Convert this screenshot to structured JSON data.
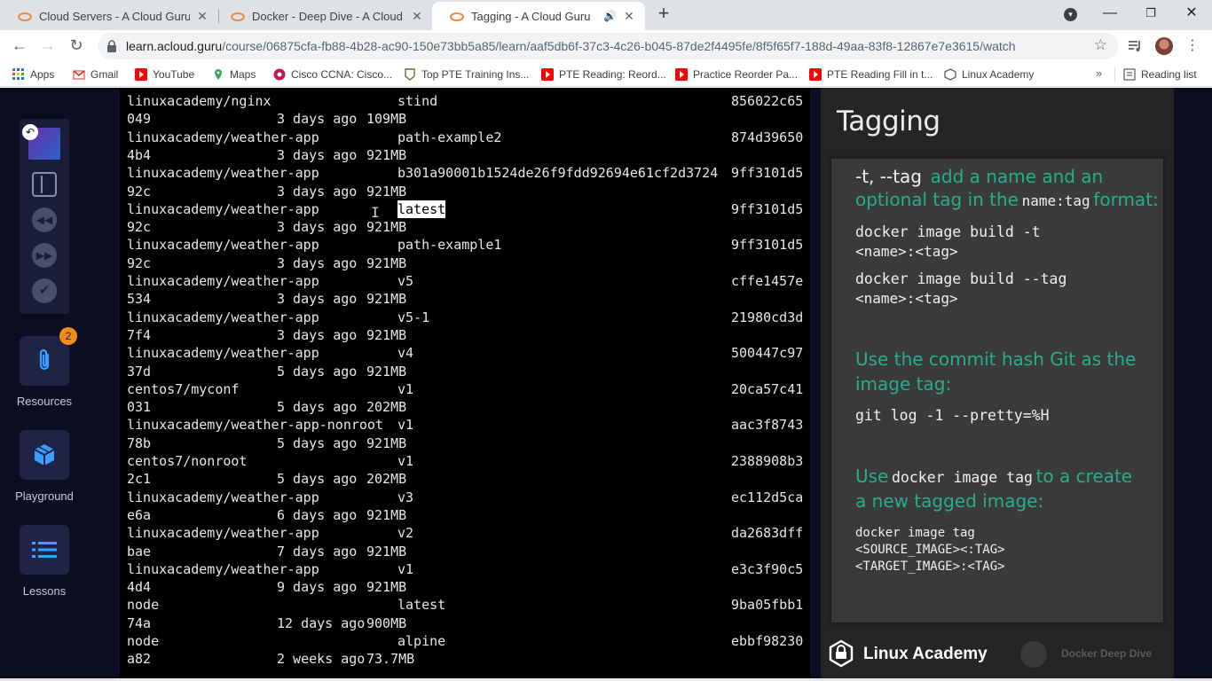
{
  "tabs": [
    {
      "title": "Cloud Servers - A Cloud Guru",
      "active": false
    },
    {
      "title": "Docker - Deep Dive - A Cloud Gu",
      "active": false
    },
    {
      "title": "Tagging - A Cloud Guru",
      "active": true,
      "audio": true
    }
  ],
  "toolbar": {
    "url_host": "learn.acloud.guru",
    "url_path": "/course/06875cfa-fb88-4b28-ac90-150e73bb5a85/learn/aaf5db6f-37c3-4c26-b045-87de2f4495fe/8f5f65f7-188d-49aa-83f8-12867e7e3615/watch"
  },
  "bookmarks": [
    {
      "label": "Apps",
      "icon": "apps-grid-icon"
    },
    {
      "label": "Gmail",
      "icon": "gmail-icon"
    },
    {
      "label": "YouTube",
      "icon": "youtube-icon"
    },
    {
      "label": "Maps",
      "icon": "maps-icon"
    },
    {
      "label": "Cisco CCNA: Cisco...",
      "icon": "cisco-icon"
    },
    {
      "label": "Top PTE Training Ins...",
      "icon": "pte-icon"
    },
    {
      "label": "PTE Reading: Reord...",
      "icon": "youtube-icon"
    },
    {
      "label": "Practice Reorder Pa...",
      "icon": "youtube-icon"
    },
    {
      "label": "PTE Reading Fill in t...",
      "icon": "youtube-icon"
    },
    {
      "label": "Linux Academy",
      "icon": "linux-academy-icon"
    }
  ],
  "reading_list": "Reading list",
  "sidebar": {
    "resources_label": "Resources",
    "resources_badge": "2",
    "playground_label": "Playground",
    "lessons_label": "Lessons"
  },
  "terminal": {
    "lines": [
      {
        "a": "linuxacademy/nginx",
        "b": "stind",
        "c": "856022c65"
      },
      {
        "a": "049",
        "b": "3 days ago",
        "c": "109MB"
      },
      {
        "a": "linuxacademy/weather-app",
        "b": "path-example2",
        "c": "874d39650"
      },
      {
        "a": "4b4",
        "b": "3 days ago",
        "c": "921MB"
      },
      {
        "a": "linuxacademy/weather-app",
        "b": "b301a90001b1524de26f9fdd92694e61cf2d3724",
        "c": "9ff3101d5"
      },
      {
        "a": "92c",
        "b": "3 days ago",
        "c": "921MB"
      },
      {
        "a": "linuxacademy/weather-app",
        "b": "latest",
        "c": "9ff3101d5"
      },
      {
        "a": "92c",
        "b": "3 days ago",
        "c": "921MB"
      },
      {
        "a": "linuxacademy/weather-app",
        "b": "path-example1",
        "c": "9ff3101d5"
      },
      {
        "a": "92c",
        "b": "3 days ago",
        "c": "921MB"
      },
      {
        "a": "linuxacademy/weather-app",
        "b": "v5",
        "c": "cffe1457e"
      },
      {
        "a": "534",
        "b": "3 days ago",
        "c": "921MB"
      },
      {
        "a": "linuxacademy/weather-app",
        "b": "v5-1",
        "c": "21980cd3d"
      },
      {
        "a": "7f4",
        "b": "3 days ago",
        "c": "921MB"
      },
      {
        "a": "linuxacademy/weather-app",
        "b": "v4",
        "c": "500447c97"
      },
      {
        "a": "37d",
        "b": "5 days ago",
        "c": "921MB"
      },
      {
        "a": "centos7/myconf",
        "b": "v1",
        "c": "20ca57c41"
      },
      {
        "a": "031",
        "b": "5 days ago",
        "c": "202MB"
      },
      {
        "a": "linuxacademy/weather-app-nonroot",
        "b": "v1",
        "c": "aac3f8743"
      },
      {
        "a": "78b",
        "b": "5 days ago",
        "c": "921MB"
      },
      {
        "a": "centos7/nonroot",
        "b": "v1",
        "c": "2388908b3"
      },
      {
        "a": "2c1",
        "b": "5 days ago",
        "c": "202MB"
      },
      {
        "a": "linuxacademy/weather-app",
        "b": "v3",
        "c": "ec112d5ca"
      },
      {
        "a": "e6a",
        "b": "6 days ago",
        "c": "921MB"
      },
      {
        "a": "linuxacademy/weather-app",
        "b": "v2",
        "c": "da2683dff"
      },
      {
        "a": "bae",
        "b": "7 days ago",
        "c": "921MB"
      },
      {
        "a": "linuxacademy/weather-app",
        "b": "v1",
        "c": "e3c3f90c5"
      },
      {
        "a": "4d4",
        "b": "9 days ago",
        "c": "921MB"
      },
      {
        "a": "node",
        "b": "latest",
        "c": "9ba05fbb1"
      },
      {
        "a": "74a",
        "b": "12 days ago",
        "c": "900MB"
      },
      {
        "a": "node",
        "b": "alpine",
        "c": "ebbf98230"
      },
      {
        "a": "a82",
        "b": "2 weeks ago",
        "c": "73.7MB"
      }
    ]
  },
  "slide": {
    "title": "Tagging",
    "flag": "-t, --tag",
    "flag_desc_1": "add a name and an",
    "flag_desc_2": "optional tag in the",
    "name_tag": "name:tag",
    "format_word": "format:",
    "cmd1_a": "docker image build -t",
    "cmd1_b": "<name>:<tag>",
    "cmd2_a": "docker image build --tag",
    "cmd2_b": "<name>:<tag>",
    "commit_1": "Use the commit hash Git as the",
    "commit_2": "image tag:",
    "git_cmd": "git log -1 --pretty=%H",
    "use_word": "Use",
    "docker_tag_cmd": "docker image tag",
    "tag_desc_1": "to a create",
    "tag_desc_2": "a new tagged image:",
    "tag_cmd_1": "docker image tag",
    "tag_cmd_2": "<SOURCE_IMAGE><:TAG>",
    "tag_cmd_3": "<TARGET_IMAGE>:<TAG>",
    "brand": "Linux Academy",
    "course": "Docker Deep Dive"
  },
  "colors": {
    "slide_green": "#25b089",
    "page_bg": "#0c0d21",
    "badge": "#f08c1a"
  }
}
